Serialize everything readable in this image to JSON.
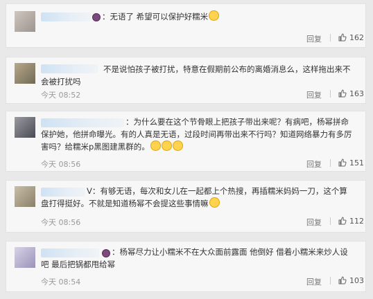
{
  "comments": [
    {
      "text": "：无语了 希望可以保护好糯米",
      "time": "",
      "reply": "回复",
      "likes": "162"
    },
    {
      "text": "不是说怕孩子被打扰，特意在假期前公布的离婚消息么，这样拖出来不会被打扰吗",
      "time": "今天 08:52",
      "reply": "回复",
      "likes": "163"
    },
    {
      "text": "：为什么要在这个节骨眼上把孩子带出来呢？有病吧，杨幂拼命保护她，他拼命曝光。有的人真是无语，过段时间再带出来不行吗？知道网络暴力有多厉害吗？给糯米p黑图建黑群的。",
      "time": "今天 08:56",
      "reply": "回复",
      "likes": "151"
    },
    {
      "text": "V：有够无语，每次和女儿在一起都上个热搜，再插糯米妈妈一刀，这个算盘打得挺好。不就是知道杨幂不会提这些事情嘛",
      "time": "今天 08:56",
      "reply": "回复",
      "likes": "112"
    },
    {
      "text": "：杨幂尽力让小糯米不在大众面前露面 他倒好 借着小糯米来炒人设吧 最后把锅都甩给幂",
      "time": "今天 08:54",
      "reply": "回复",
      "likes": "103"
    }
  ]
}
